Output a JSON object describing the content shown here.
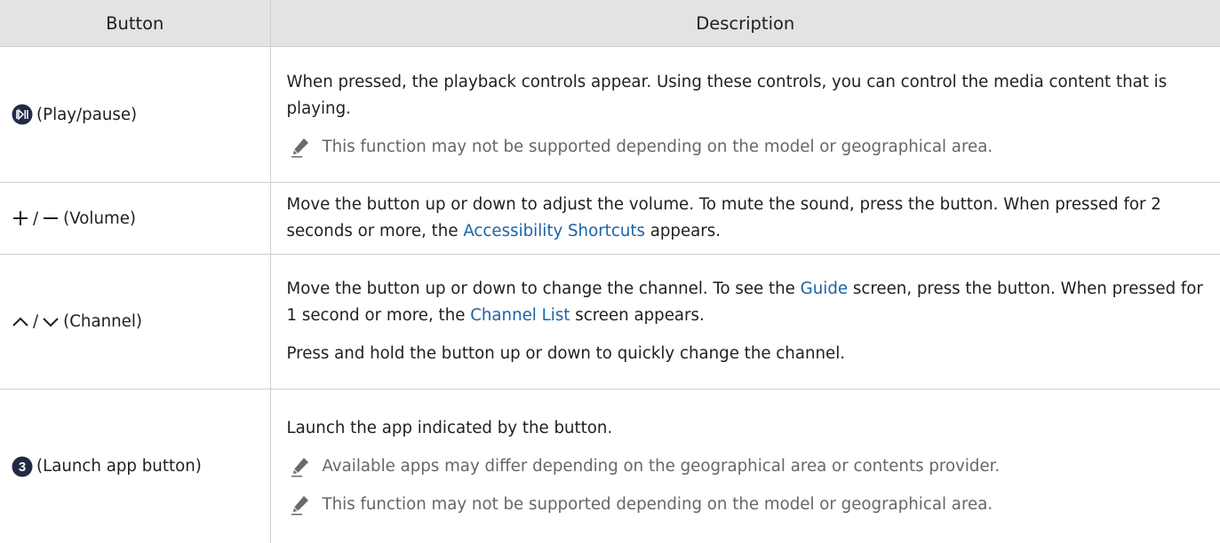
{
  "header": {
    "col_button": "Button",
    "col_description": "Description"
  },
  "rows": [
    {
      "button_label": "(Play/pause)",
      "icon": "play-pause-icon",
      "description": "When pressed, the playback controls appear. Using these controls, you can control the media content that is playing.",
      "note": "This function may not be supported depending on the model or geographical area."
    },
    {
      "button_label": "(Volume)",
      "icon": "plus-minus-icon",
      "separator": "/",
      "desc_a": "Move the button up or down to adjust the volume. To mute the sound, press the button. When pressed for 2 seconds or more, the ",
      "link": "Accessibility Shortcuts",
      "desc_b": " appears."
    },
    {
      "button_label": "(Channel)",
      "icon": "chevron-up-down-icon",
      "separator": "/",
      "desc_a": "Move the button up or down to change the channel. To see the ",
      "link1": "Guide",
      "desc_b": " screen, press the button. When pressed for 1 second or more, the ",
      "link2": "Channel List",
      "desc_c": " screen appears.",
      "desc2": "Press and hold the button up or down to quickly change the channel."
    },
    {
      "button_label": "(Launch app button)",
      "icon": "number-3-icon",
      "badge_number": "3",
      "description": "Launch the app indicated by the button.",
      "note1": "Available apps may differ depending on the geographical area or contents provider.",
      "note2": "This function may not be supported depending on the model or geographical area."
    }
  ],
  "colors": {
    "header_bg": "#e3e3e3",
    "link": "#1a63a8",
    "note_text": "#666666",
    "icon_dark": "#1f2a44"
  }
}
